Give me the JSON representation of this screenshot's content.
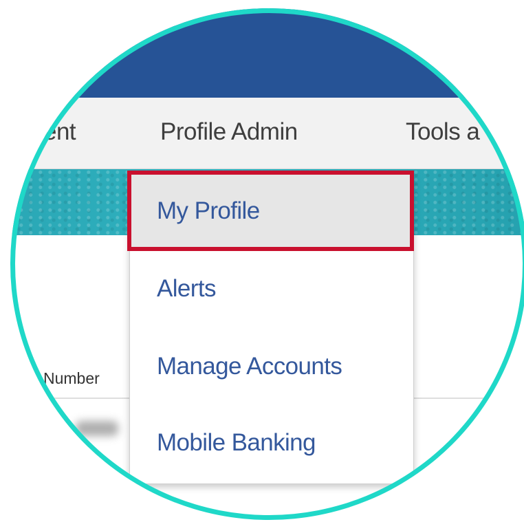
{
  "nav": {
    "items": [
      {
        "label": "ent"
      },
      {
        "label": "Profile Admin"
      },
      {
        "label": "Tools a"
      }
    ]
  },
  "table": {
    "column_header": "Number"
  },
  "dropdown": {
    "items": [
      {
        "label": "My Profile",
        "highlighted": true
      },
      {
        "label": "Alerts"
      },
      {
        "label": "Manage Accounts"
      },
      {
        "label": "Mobile Banking"
      }
    ]
  },
  "colors": {
    "top_bar": "#265396",
    "teal_band": "#2aa7b5",
    "menu_text": "#34589c",
    "highlight": "#c9102e",
    "lens_ring": "#1fd8c8"
  }
}
